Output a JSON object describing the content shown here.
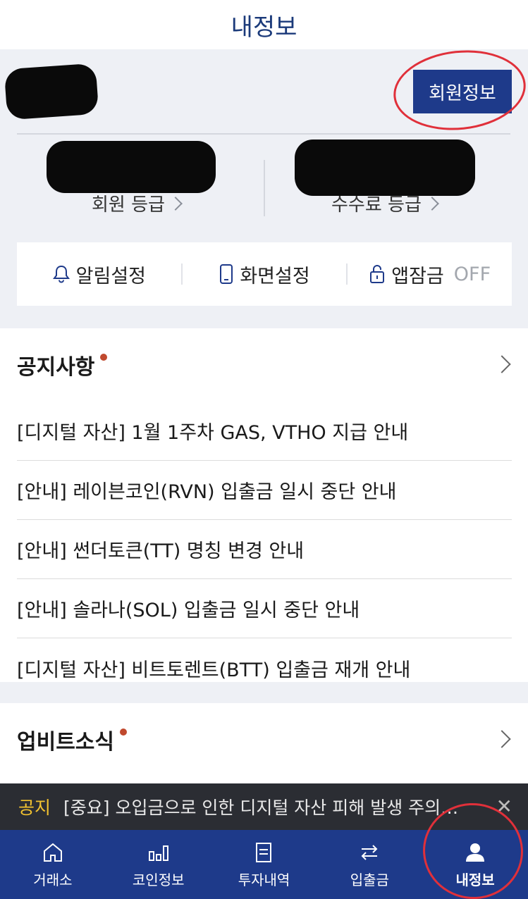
{
  "header": {
    "title": "내정보"
  },
  "profile": {
    "member_info_button": "회원정보",
    "member_grade_label": "회원 등급",
    "fee_grade_label": "수수료 등급"
  },
  "settings": {
    "items": [
      {
        "label": "알림설정",
        "icon": "bell-icon"
      },
      {
        "label": "화면설정",
        "icon": "phone-icon"
      },
      {
        "label": "앱잠금",
        "icon": "lock-icon",
        "status": "OFF"
      }
    ]
  },
  "notices": {
    "title": "공지사항",
    "items": [
      "[디지털 자산] 1월 1주차 GAS, VTHO 지급 안내",
      "[안내] 레이븐코인(RVN) 입출금 일시 중단 안내",
      "[안내] 썬더토큰(TT) 명칭 변경 안내",
      "[안내] 솔라나(SOL) 입출금 일시 중단 안내",
      "[디지털 자산] 비트토렌트(BTT) 입출금 재개 안내"
    ]
  },
  "news": {
    "title": "업비트소식"
  },
  "ticker": {
    "tag": "공지",
    "message": "[중요] 오입금으로 인한 디지털 자산 피해 발생 주의…"
  },
  "tabbar": {
    "tabs": [
      {
        "label": "거래소",
        "icon": "home-icon"
      },
      {
        "label": "코인정보",
        "icon": "bar-chart-icon"
      },
      {
        "label": "투자내역",
        "icon": "document-icon"
      },
      {
        "label": "입출금",
        "icon": "transfer-icon"
      },
      {
        "label": "내정보",
        "icon": "user-icon",
        "active": true
      }
    ]
  },
  "colors": {
    "brand": "#1e3a8a",
    "title": "#1b3a7a",
    "ticker_bg": "#2b2d33",
    "ticker_tag": "#f2c230",
    "dot": "#c0492e",
    "annotation": "#e0303a"
  }
}
